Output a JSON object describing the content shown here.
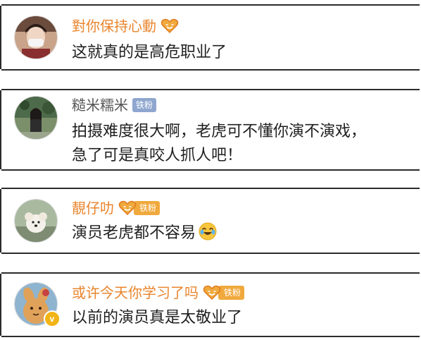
{
  "comments": [
    {
      "username": "對你保持心動",
      "text": "这就真的是高危职业了",
      "badge": "heart-icon"
    },
    {
      "username": "糙米糯米",
      "fan_label": "铁粉",
      "text_line1": "拍摄难度很大啊，老虎可不懂你演不演戏，",
      "text_line2": "急了可是真咬人抓人吧！"
    },
    {
      "username": "靚仔叻",
      "fan_label": "铁粉",
      "text": "演员老虎都不容易",
      "emoji": "laughing-crying-emoji"
    },
    {
      "username": "或许今天你学习了吗",
      "fan_label": "铁粉",
      "text": "以前的演员真是太敬业了",
      "verified_label": "v"
    }
  ],
  "colors": {
    "username_orange": "#e9852e",
    "username_gray": "#555555",
    "fan_badge_blue": "#8fa6cf",
    "fan_badge_gold": "#f0a93d",
    "verified_yellow": "#f2b416",
    "comment_text": "#1f1f1f"
  }
}
